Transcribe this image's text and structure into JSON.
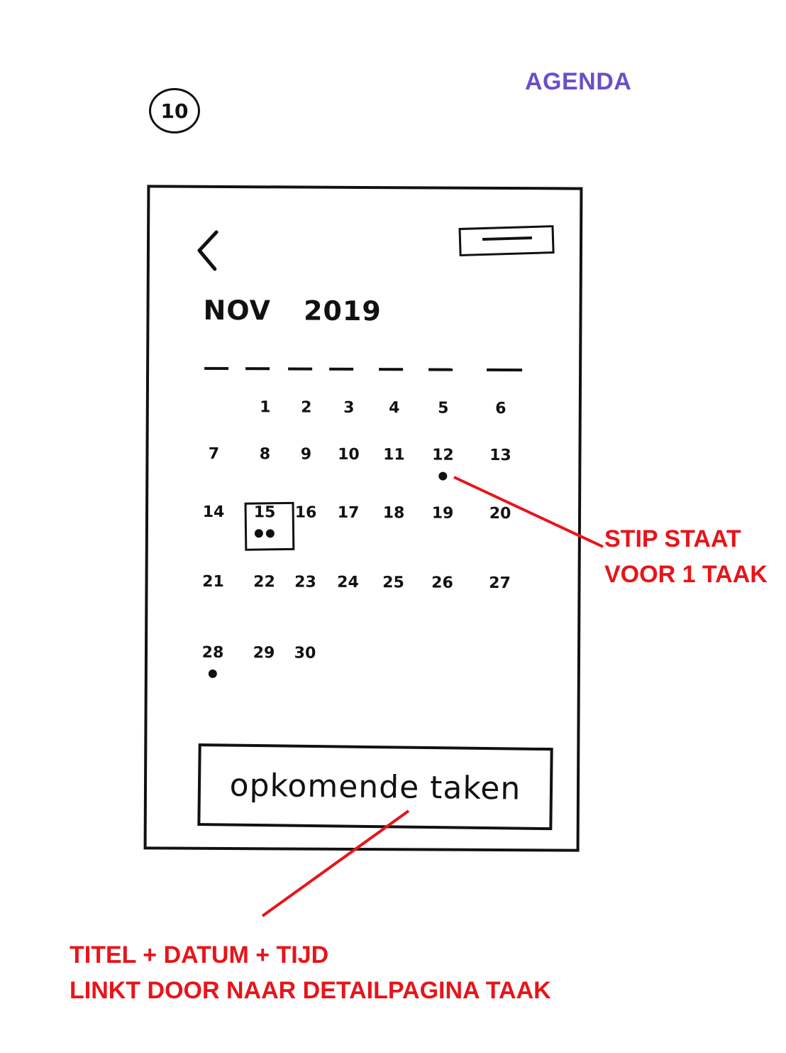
{
  "sheet_number": "10",
  "page_label": "AGENDA",
  "header": {
    "month": "NOV",
    "year": "2019"
  },
  "calendar": {
    "weekday_count": 7,
    "days": [
      {
        "label": "1",
        "col": 1,
        "row": 0
      },
      {
        "label": "2",
        "col": 2,
        "row": 0
      },
      {
        "label": "3",
        "col": 3,
        "row": 0
      },
      {
        "label": "4",
        "col": 4,
        "row": 0
      },
      {
        "label": "5",
        "col": 5,
        "row": 0
      },
      {
        "label": "6",
        "col": 6,
        "row": 0
      },
      {
        "label": "7",
        "col": 0,
        "row": 1
      },
      {
        "label": "8",
        "col": 1,
        "row": 1
      },
      {
        "label": "9",
        "col": 2,
        "row": 1
      },
      {
        "label": "10",
        "col": 3,
        "row": 1
      },
      {
        "label": "11",
        "col": 4,
        "row": 1
      },
      {
        "label": "12",
        "col": 5,
        "row": 1,
        "dots": 1
      },
      {
        "label": "13",
        "col": 6,
        "row": 1
      },
      {
        "label": "14",
        "col": 0,
        "row": 2
      },
      {
        "label": "15",
        "col": 1,
        "row": 2,
        "dots": 2,
        "selected": true
      },
      {
        "label": "16",
        "col": 2,
        "row": 2
      },
      {
        "label": "17",
        "col": 3,
        "row": 2
      },
      {
        "label": "18",
        "col": 4,
        "row": 2
      },
      {
        "label": "19",
        "col": 5,
        "row": 2
      },
      {
        "label": "20",
        "col": 6,
        "row": 2
      },
      {
        "label": "21",
        "col": 0,
        "row": 3
      },
      {
        "label": "22",
        "col": 1,
        "row": 3
      },
      {
        "label": "23",
        "col": 2,
        "row": 3
      },
      {
        "label": "24",
        "col": 3,
        "row": 3
      },
      {
        "label": "25",
        "col": 4,
        "row": 3
      },
      {
        "label": "26",
        "col": 5,
        "row": 3
      },
      {
        "label": "27",
        "col": 6,
        "row": 3
      },
      {
        "label": "28",
        "col": 0,
        "row": 4,
        "dots": 1
      },
      {
        "label": "29",
        "col": 1,
        "row": 4
      },
      {
        "label": "30",
        "col": 2,
        "row": 4
      }
    ]
  },
  "upcoming_label": "opkomende taken",
  "annotations": {
    "dot_note": [
      "STIP STAAT",
      "VOOR 1 TAAK"
    ],
    "upcoming_note": [
      "TITEL + DATUM + TIJD",
      "LINKT DOOR NAAR DETAILPAGINA TAAK"
    ]
  },
  "colors": {
    "note": "#e8141a",
    "label": "#6a4fc8",
    "ink": "#111111"
  },
  "icons": {
    "back": "chevron-left-icon",
    "menu": "menu-icon"
  }
}
